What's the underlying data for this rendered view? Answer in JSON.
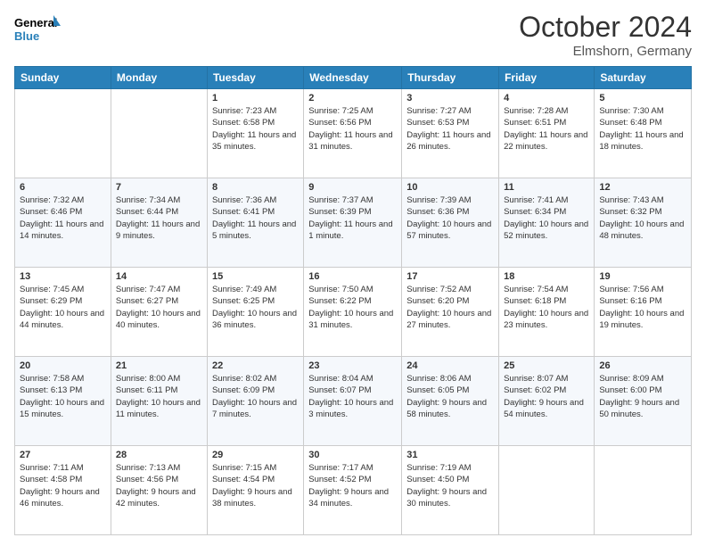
{
  "header": {
    "logo_line1": "General",
    "logo_line2": "Blue",
    "month": "October 2024",
    "location": "Elmshorn, Germany"
  },
  "days_of_week": [
    "Sunday",
    "Monday",
    "Tuesday",
    "Wednesday",
    "Thursday",
    "Friday",
    "Saturday"
  ],
  "weeks": [
    [
      {
        "day": "",
        "info": ""
      },
      {
        "day": "",
        "info": ""
      },
      {
        "day": "1",
        "info": "Sunrise: 7:23 AM\nSunset: 6:58 PM\nDaylight: 11 hours and 35 minutes."
      },
      {
        "day": "2",
        "info": "Sunrise: 7:25 AM\nSunset: 6:56 PM\nDaylight: 11 hours and 31 minutes."
      },
      {
        "day": "3",
        "info": "Sunrise: 7:27 AM\nSunset: 6:53 PM\nDaylight: 11 hours and 26 minutes."
      },
      {
        "day": "4",
        "info": "Sunrise: 7:28 AM\nSunset: 6:51 PM\nDaylight: 11 hours and 22 minutes."
      },
      {
        "day": "5",
        "info": "Sunrise: 7:30 AM\nSunset: 6:48 PM\nDaylight: 11 hours and 18 minutes."
      }
    ],
    [
      {
        "day": "6",
        "info": "Sunrise: 7:32 AM\nSunset: 6:46 PM\nDaylight: 11 hours and 14 minutes."
      },
      {
        "day": "7",
        "info": "Sunrise: 7:34 AM\nSunset: 6:44 PM\nDaylight: 11 hours and 9 minutes."
      },
      {
        "day": "8",
        "info": "Sunrise: 7:36 AM\nSunset: 6:41 PM\nDaylight: 11 hours and 5 minutes."
      },
      {
        "day": "9",
        "info": "Sunrise: 7:37 AM\nSunset: 6:39 PM\nDaylight: 11 hours and 1 minute."
      },
      {
        "day": "10",
        "info": "Sunrise: 7:39 AM\nSunset: 6:36 PM\nDaylight: 10 hours and 57 minutes."
      },
      {
        "day": "11",
        "info": "Sunrise: 7:41 AM\nSunset: 6:34 PM\nDaylight: 10 hours and 52 minutes."
      },
      {
        "day": "12",
        "info": "Sunrise: 7:43 AM\nSunset: 6:32 PM\nDaylight: 10 hours and 48 minutes."
      }
    ],
    [
      {
        "day": "13",
        "info": "Sunrise: 7:45 AM\nSunset: 6:29 PM\nDaylight: 10 hours and 44 minutes."
      },
      {
        "day": "14",
        "info": "Sunrise: 7:47 AM\nSunset: 6:27 PM\nDaylight: 10 hours and 40 minutes."
      },
      {
        "day": "15",
        "info": "Sunrise: 7:49 AM\nSunset: 6:25 PM\nDaylight: 10 hours and 36 minutes."
      },
      {
        "day": "16",
        "info": "Sunrise: 7:50 AM\nSunset: 6:22 PM\nDaylight: 10 hours and 31 minutes."
      },
      {
        "day": "17",
        "info": "Sunrise: 7:52 AM\nSunset: 6:20 PM\nDaylight: 10 hours and 27 minutes."
      },
      {
        "day": "18",
        "info": "Sunrise: 7:54 AM\nSunset: 6:18 PM\nDaylight: 10 hours and 23 minutes."
      },
      {
        "day": "19",
        "info": "Sunrise: 7:56 AM\nSunset: 6:16 PM\nDaylight: 10 hours and 19 minutes."
      }
    ],
    [
      {
        "day": "20",
        "info": "Sunrise: 7:58 AM\nSunset: 6:13 PM\nDaylight: 10 hours and 15 minutes."
      },
      {
        "day": "21",
        "info": "Sunrise: 8:00 AM\nSunset: 6:11 PM\nDaylight: 10 hours and 11 minutes."
      },
      {
        "day": "22",
        "info": "Sunrise: 8:02 AM\nSunset: 6:09 PM\nDaylight: 10 hours and 7 minutes."
      },
      {
        "day": "23",
        "info": "Sunrise: 8:04 AM\nSunset: 6:07 PM\nDaylight: 10 hours and 3 minutes."
      },
      {
        "day": "24",
        "info": "Sunrise: 8:06 AM\nSunset: 6:05 PM\nDaylight: 9 hours and 58 minutes."
      },
      {
        "day": "25",
        "info": "Sunrise: 8:07 AM\nSunset: 6:02 PM\nDaylight: 9 hours and 54 minutes."
      },
      {
        "day": "26",
        "info": "Sunrise: 8:09 AM\nSunset: 6:00 PM\nDaylight: 9 hours and 50 minutes."
      }
    ],
    [
      {
        "day": "27",
        "info": "Sunrise: 7:11 AM\nSunset: 4:58 PM\nDaylight: 9 hours and 46 minutes."
      },
      {
        "day": "28",
        "info": "Sunrise: 7:13 AM\nSunset: 4:56 PM\nDaylight: 9 hours and 42 minutes."
      },
      {
        "day": "29",
        "info": "Sunrise: 7:15 AM\nSunset: 4:54 PM\nDaylight: 9 hours and 38 minutes."
      },
      {
        "day": "30",
        "info": "Sunrise: 7:17 AM\nSunset: 4:52 PM\nDaylight: 9 hours and 34 minutes."
      },
      {
        "day": "31",
        "info": "Sunrise: 7:19 AM\nSunset: 4:50 PM\nDaylight: 9 hours and 30 minutes."
      },
      {
        "day": "",
        "info": ""
      },
      {
        "day": "",
        "info": ""
      }
    ]
  ]
}
